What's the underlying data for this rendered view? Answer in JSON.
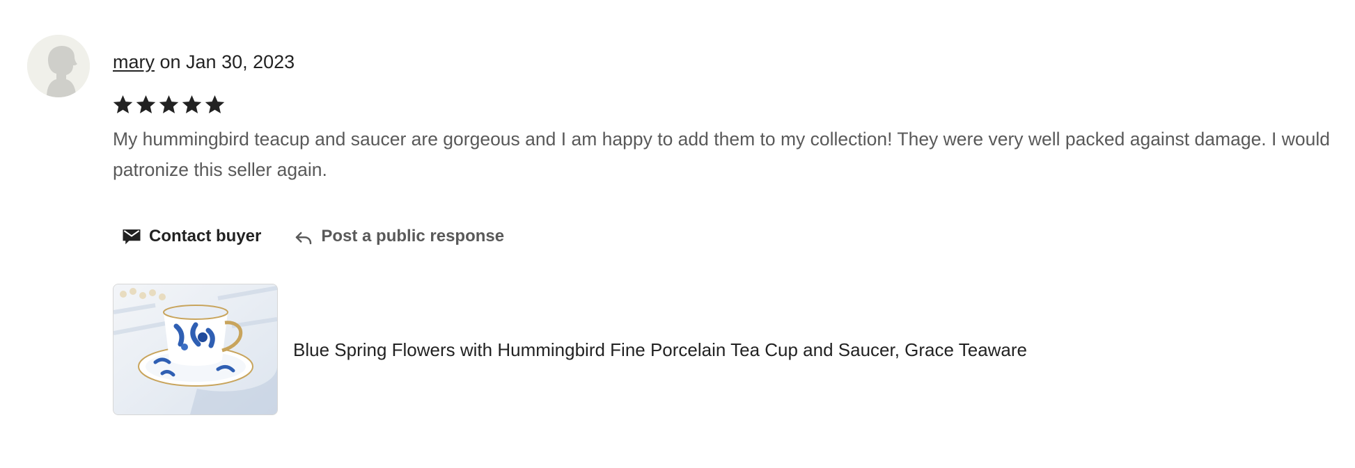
{
  "review": {
    "username": "mary",
    "date_text": " on Jan 30, 2023",
    "rating": 5,
    "rating_max": 5,
    "text": "My hummingbird teacup and saucer are gorgeous and I am happy to add them to my collection! They were very well packed against damage. I would patronize this seller again."
  },
  "actions": {
    "contact_label": "Contact buyer",
    "respond_label": "Post a public response"
  },
  "listing": {
    "title": "Blue Spring Flowers with Hummingbird Fine Porcelain Tea Cup and Saucer, Grace Teaware"
  },
  "icons": {
    "avatar": "default-user-silhouette",
    "star": "star-filled-icon",
    "contact": "envelope-icon",
    "respond": "reply-arrow-icon"
  },
  "colors": {
    "text_primary": "#222222",
    "text_secondary": "#595959",
    "avatar_bg": "#f0f0ea",
    "avatar_figure": "#cfcfca"
  }
}
